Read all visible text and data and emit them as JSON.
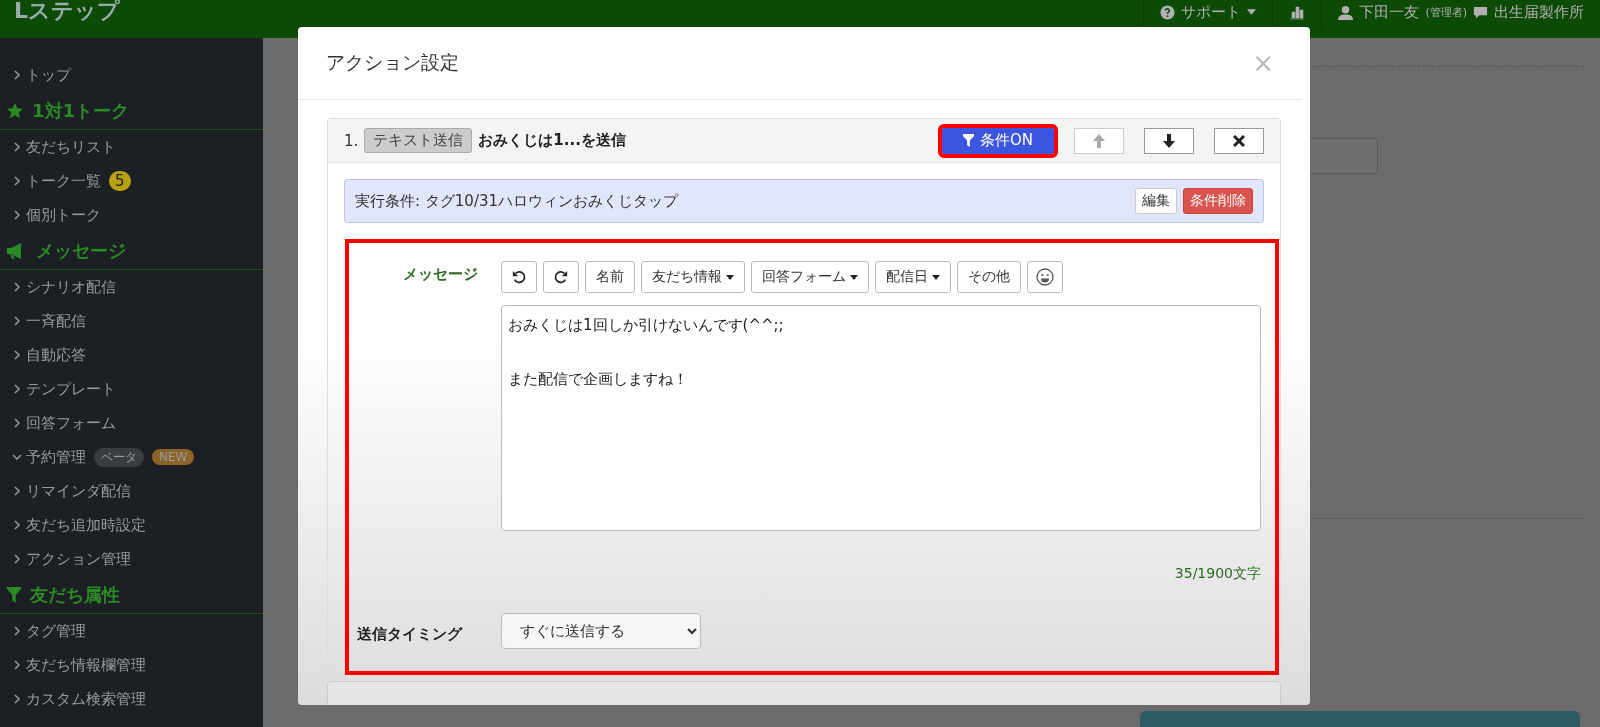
{
  "topbar": {
    "logo": "Lステップ",
    "support": "サポート",
    "user": "下田一友",
    "role": "(管理者)",
    "account": "出生届製作所"
  },
  "sidebar": {
    "items": [
      {
        "kind": "link",
        "label": "トップ",
        "expanded": false
      },
      {
        "kind": "section",
        "label": "1対1トーク"
      },
      {
        "kind": "link",
        "label": "友だちリスト",
        "expanded": false
      },
      {
        "kind": "link",
        "label": "トーク一覧",
        "expanded": false,
        "badges": [
          {
            "text": "5",
            "color": "#b8a10f"
          }
        ]
      },
      {
        "kind": "link",
        "label": "個別トーク",
        "expanded": false
      },
      {
        "kind": "section",
        "label": "メッセージ"
      },
      {
        "kind": "link",
        "label": "シナリオ配信",
        "expanded": false
      },
      {
        "kind": "link",
        "label": "一斉配信",
        "expanded": false
      },
      {
        "kind": "link",
        "label": "自動応答",
        "expanded": false
      },
      {
        "kind": "link",
        "label": "テンプレート",
        "expanded": false
      },
      {
        "kind": "link",
        "label": "回答フォーム",
        "expanded": false
      },
      {
        "kind": "link",
        "label": "予約管理",
        "expanded": true,
        "badges": [
          {
            "text": "ベータ",
            "color": "#3a3d40"
          },
          {
            "text": "NEW",
            "color": "#8a6428"
          }
        ]
      },
      {
        "kind": "link",
        "label": "リマインダ配信",
        "expanded": false
      },
      {
        "kind": "link",
        "label": "友だち追加時設定",
        "expanded": false
      },
      {
        "kind": "link",
        "label": "アクション管理",
        "expanded": false
      },
      {
        "kind": "section",
        "label": "友だち属性"
      },
      {
        "kind": "link",
        "label": "タグ管理",
        "expanded": false
      },
      {
        "kind": "link",
        "label": "友だち情報欄管理",
        "expanded": false
      },
      {
        "kind": "link",
        "label": "カスタム検索管理",
        "expanded": false
      }
    ]
  },
  "modal": {
    "title": "アクション設定",
    "close": "×",
    "action": {
      "number": "1.",
      "type": "テキスト送信",
      "summary": "おみくじは1...を送信",
      "buttons": [
        {
          "kind": "condition",
          "label": "条件ON",
          "highlighted": true,
          "disabled": false
        },
        {
          "kind": "up",
          "disabled": true
        },
        {
          "kind": "down",
          "disabled": false
        },
        {
          "kind": "remove",
          "disabled": false
        }
      ],
      "condition": {
        "text": "実行条件: タグ10/31ハロウィンおみくじタップ",
        "edit": "編集",
        "delete": "条件削除"
      },
      "editor": {
        "highlighted": true,
        "label": "メッセージ",
        "toolbar": [
          {
            "kind": "undo"
          },
          {
            "kind": "redo"
          },
          {
            "kind": "text",
            "label": "名前"
          },
          {
            "kind": "dropdown",
            "label": "友だち情報"
          },
          {
            "kind": "dropdown",
            "label": "回答フォーム"
          },
          {
            "kind": "dropdown",
            "label": "配信日"
          },
          {
            "kind": "text",
            "label": "その他"
          },
          {
            "kind": "emoji"
          }
        ],
        "value": "おみくじは1回しか引けないんです(^^;;\n\nまた配信で企画しますね！",
        "counter": "35/1900文字",
        "timing_label": "送信タイミング",
        "timing": "すぐに送信する"
      }
    }
  }
}
